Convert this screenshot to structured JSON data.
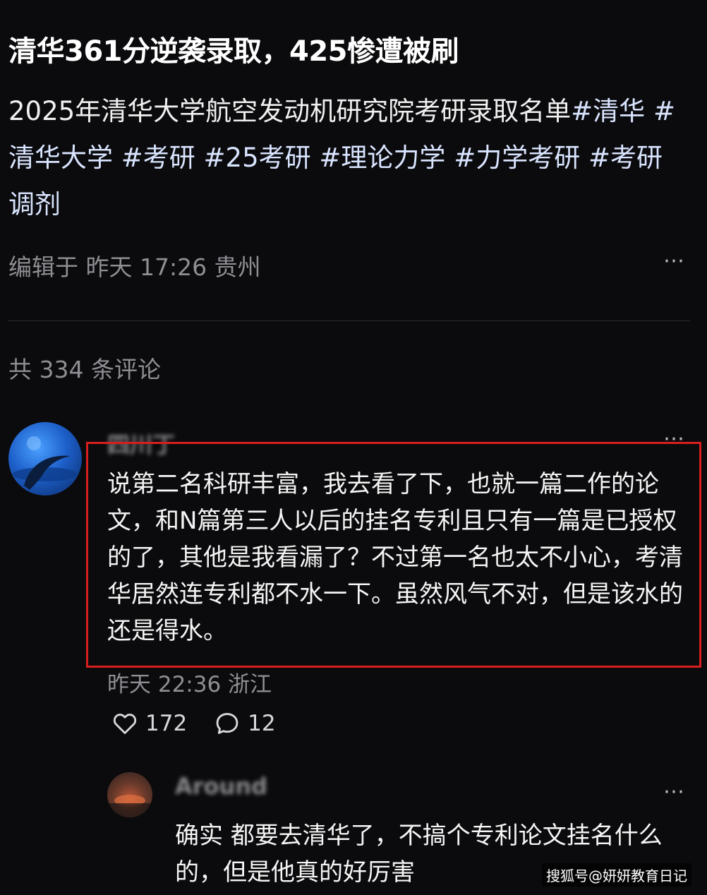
{
  "post": {
    "title": "清华361分逆袭录取，425惨遭被刷",
    "body_text": "2025年清华大学航空发动机研究院考研录取名单",
    "hashtags": [
      "#清华",
      "#清华大学",
      "#考研",
      "#25考研",
      "#理论力学",
      "#力学考研",
      "#考研调剂"
    ],
    "meta": "编辑于 昨天 17:26 贵州",
    "more_icon": "⋯"
  },
  "comments_header": {
    "count_label": "共 334 条评论"
  },
  "comment": {
    "username": "四川丁",
    "text": "说第二名科研丰富，我去看了下，也就一篇二作的论文，和N篇第三人以后的挂名专利且只有一篇是已授权的了，其他是我看漏了？不过第一名也太不小心，考清华居然连专利都不水一下。虽然风气不对，但是该水的还是得水。",
    "meta": "昨天 22:36 浙江",
    "likes": "172",
    "replies": "12",
    "more_icon": "⋯",
    "highlight_color": "#d81e1e"
  },
  "reply": {
    "username": "Around",
    "text": "确实 都要去清华了，不搞个专利论文挂名什么的，但是他真的好厉害",
    "more_icon": "⋯"
  },
  "watermark": "搜狐号@妍妍教育日记",
  "icons": {
    "like": "heart-icon",
    "reply": "comment-bubble-icon",
    "more": "more-dots-icon"
  }
}
